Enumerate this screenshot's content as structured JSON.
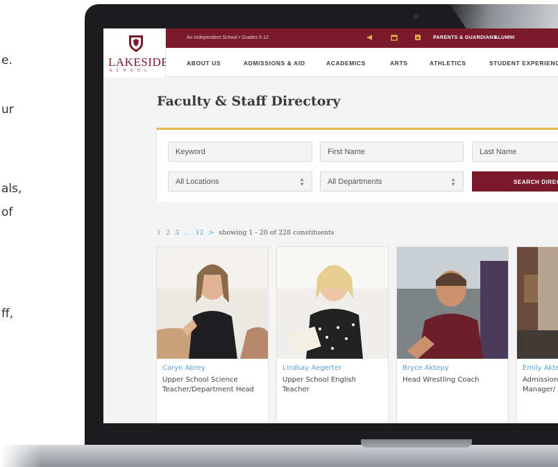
{
  "side_fragments": [
    "e.",
    "ur",
    "als,",
    "of",
    "ff,"
  ],
  "site": {
    "logo_text": "LAKESIDE",
    "logo_subtext": "SCHOOL",
    "tagline": "An Independent School • Grades 5-12",
    "utility_links": [
      "PARENTS & GUARDIANS",
      "ALUMNI"
    ],
    "brand_color": "#7a1a2a",
    "accent_color": "#e2b64a",
    "link_color": "#5aa0d8"
  },
  "nav": [
    "ABOUT US",
    "ADMISSIONS & AID",
    "ACADEMICS",
    "ARTS",
    "ATHLETICS",
    "STUDENT EXPERIENC"
  ],
  "page": {
    "title": "Faculty & Staff Directory"
  },
  "search": {
    "keyword_placeholder": "Keyword",
    "first_name_placeholder": "First Name",
    "last_name_placeholder": "Last Name",
    "location_selected": "All Locations",
    "department_selected": "All Departments",
    "button_label": "SEARCH DIREC"
  },
  "pagination": {
    "pages": [
      "1",
      "2",
      "3",
      "...",
      "12",
      ">"
    ],
    "summary": "showing 1 - 20 of 228 constituents"
  },
  "people": [
    {
      "name": "Caryn Abrey",
      "title": "Upper School Science Teacher/Department Head"
    },
    {
      "name": "Lindsay Aegerter",
      "title": "Upper School English Teacher"
    },
    {
      "name": "Bryce Aktepy",
      "title": "Head Wrestling Coach"
    },
    {
      "name": "Emily Akte",
      "title": "Admission Aid Opera Manager/ Associate"
    }
  ],
  "icons": [
    "megaphone-icon",
    "calendar-icon",
    "id-card-icon",
    "chevron-updown-icon"
  ]
}
